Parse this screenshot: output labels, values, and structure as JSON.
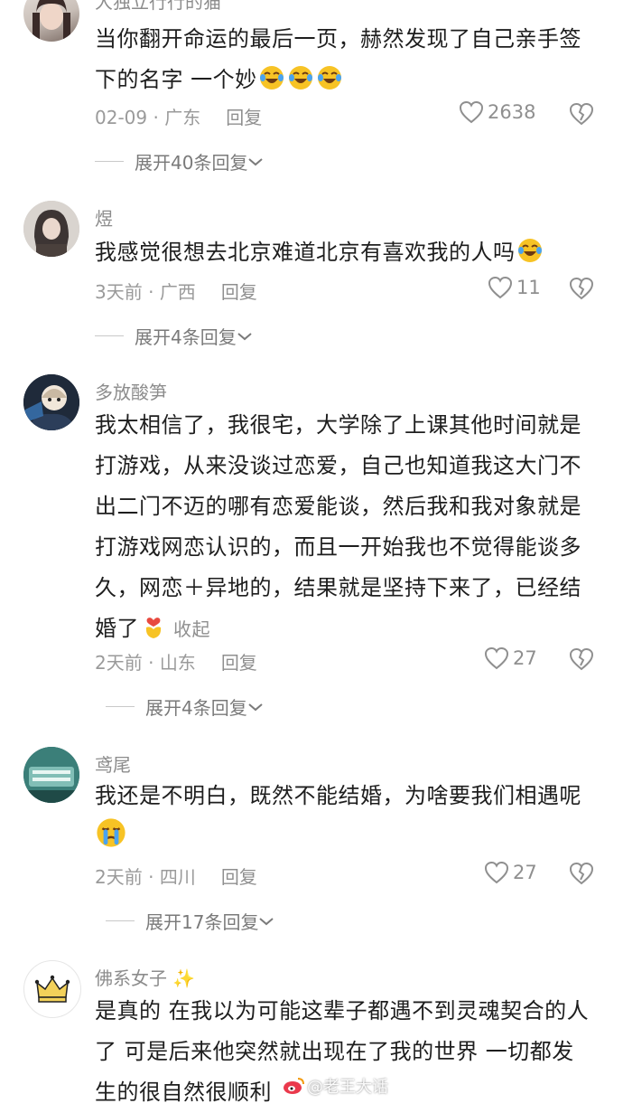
{
  "comments": [
    {
      "username": "大独立行行的猫",
      "lines": [
        "当你翻开命运的最后一页，赫然发现了自己亲手签",
        "下的名字 一个妙"
      ],
      "emoji_count": 3,
      "date": "02-09",
      "location": "广东",
      "reply_label": "回复",
      "likes": "2638",
      "expand_label": "展开40条回复"
    },
    {
      "username": "煜",
      "lines": [
        "我感觉很想去北京难道北京有喜欢我的人吗"
      ],
      "emoji_count": 1,
      "date": "3天前",
      "location": "广西",
      "reply_label": "回复",
      "likes": "11",
      "expand_label": "展开4条回复"
    },
    {
      "username": "多放酸笋",
      "lines": [
        "我太相信了，我很宅，大学除了上课其他时间就是",
        "打游戏，从来没谈过恋爱，自己也知道我这大门不",
        "出二门不迈的哪有恋爱能谈，然后我和我对象就是",
        "打游戏网恋认识的，而且一开始我也不觉得能谈多",
        "久，网恋＋异地的，结果就是坚持下来了，已经结",
        "婚了"
      ],
      "collapse_label": "收起",
      "date": "2天前",
      "location": "山东",
      "reply_label": "回复",
      "likes": "27",
      "expand_label": "展开4条回复"
    },
    {
      "username": "鸢尾",
      "lines": [
        "我还是不明白，既然不能结婚，为啥要我们相遇呢"
      ],
      "date": "2天前",
      "location": "四川",
      "reply_label": "回复",
      "likes": "27",
      "expand_label": "展开17条回复"
    },
    {
      "username": "佛系女子",
      "lines": [
        "是真的 在我以为可能这辈子都遇不到灵魂契合的人",
        "了 可是后来他突然就出现在了我的世界 一切都发",
        "生的很自然很顺利"
      ]
    }
  ],
  "watermark": "@老王大话",
  "colors": {
    "text": "#1e1e1e",
    "meta": "#9a9a9a",
    "emoji_yellow": "#f7c325",
    "emoji_blue": "#4aa3f0"
  }
}
